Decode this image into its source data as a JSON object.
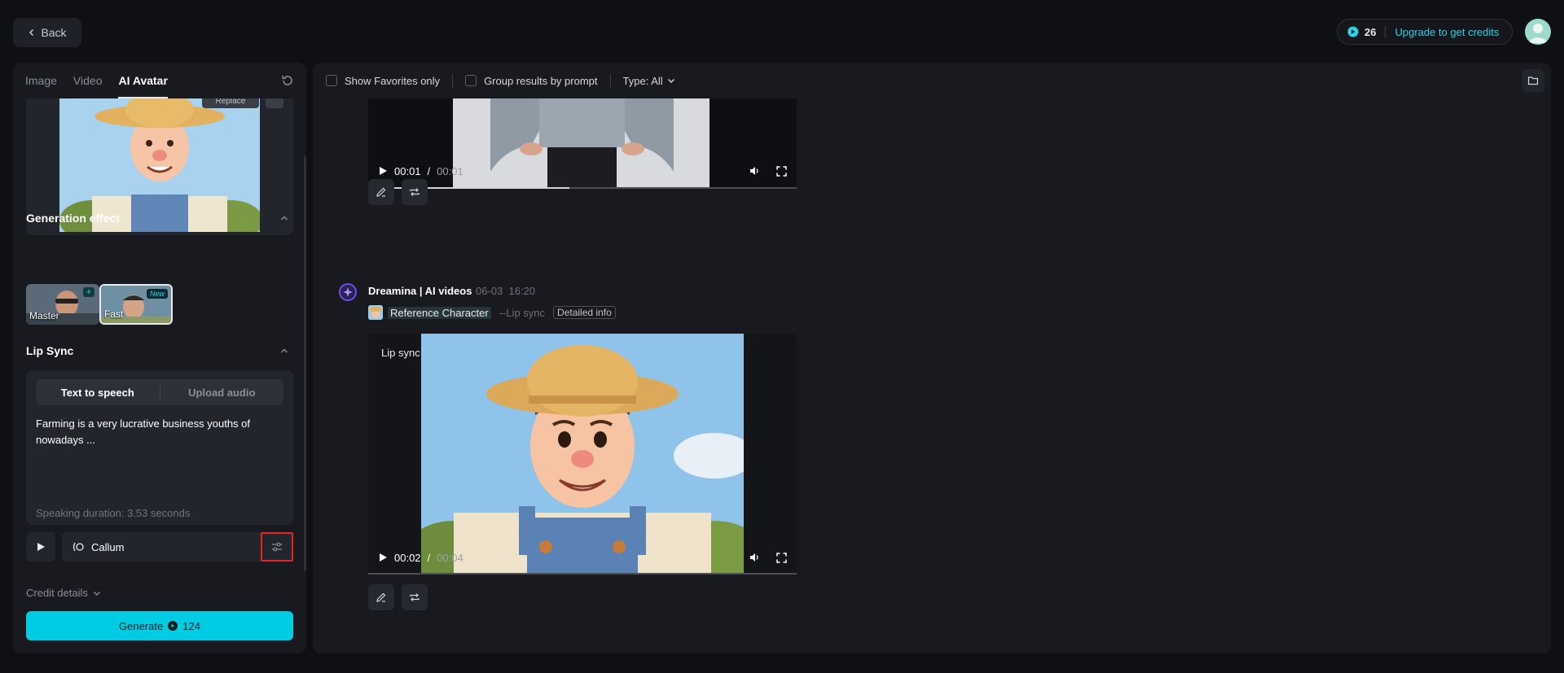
{
  "topbar": {
    "back_label": "Back",
    "credits": "26",
    "upgrade_label": "Upgrade to get credits"
  },
  "left": {
    "tabs": [
      {
        "label": "Image"
      },
      {
        "label": "Video"
      },
      {
        "label": "AI Avatar"
      }
    ],
    "replace_label": "Replace",
    "generation_effect": {
      "title": "Generation effect",
      "options": [
        {
          "label": "Master"
        },
        {
          "label": "Fast",
          "badge": "New"
        }
      ]
    },
    "lip_sync": {
      "title": "Lip Sync",
      "modes": [
        "Text to speech",
        "Upload audio"
      ],
      "text": "Farming is a very lucrative business youths of nowadays ...",
      "duration": "Speaking duration: 3.53 seconds"
    },
    "voice": "Callum",
    "credit_details": "Credit details",
    "generate": {
      "label": "Generate",
      "cost": "124"
    }
  },
  "right": {
    "filters": {
      "favorites": "Show Favorites only",
      "group": "Group results by prompt",
      "type": "Type: All"
    },
    "results": [
      {
        "current": "00:01",
        "separator": "/",
        "total": "00:01",
        "progress": 0.47
      },
      {
        "author": "Dreamina | AI videos",
        "date": "06-03",
        "time": "16:20",
        "reference": "Reference Character",
        "mode": "--Lip sync",
        "info": "Detailed info",
        "overlay_label": "Lip sync",
        "current": "00:02",
        "separator": "/",
        "total": "00:04",
        "progress": 0
      }
    ]
  },
  "colors": {
    "accent": "#00cde3",
    "highlight": "#e0262b",
    "background": "#0f1013",
    "panel": "#181a1f"
  }
}
